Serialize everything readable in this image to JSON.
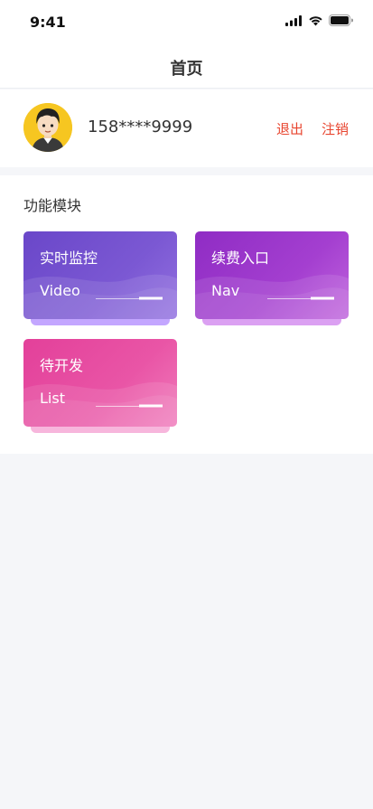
{
  "status": {
    "time": "9:41"
  },
  "nav": {
    "title": "首页"
  },
  "profile": {
    "phone": "158****9999",
    "logout_label": "退出",
    "cancel_label": "注销"
  },
  "modules": {
    "title": "功能模块",
    "cards": [
      {
        "title": "实时监控",
        "subtitle": "Video",
        "color": "#7b58d3"
      },
      {
        "title": "续费入口",
        "subtitle": "Nav",
        "color": "#a43fd0"
      },
      {
        "title": "待开发",
        "subtitle": "List",
        "color": "#e955a6"
      }
    ]
  }
}
